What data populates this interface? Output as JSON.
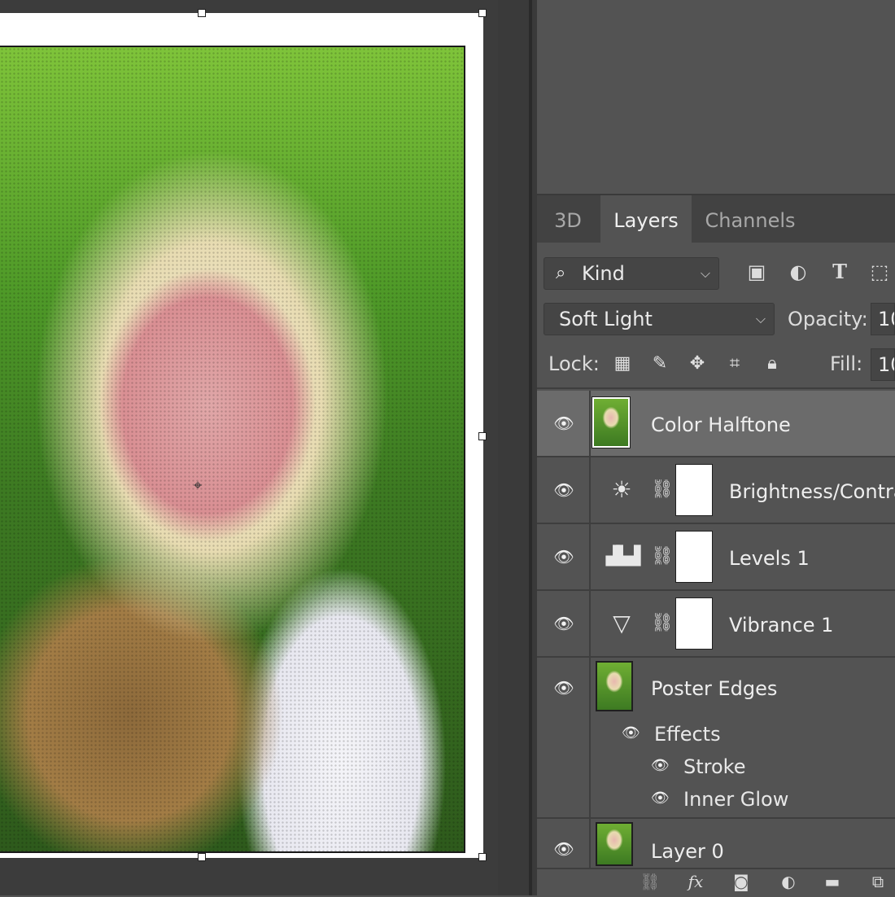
{
  "tabs": [
    "3D",
    "Layers",
    "Channels"
  ],
  "filter": {
    "label": "Kind",
    "icons": [
      "image-icon",
      "adjustment-icon",
      "type-icon",
      "shape-icon"
    ]
  },
  "blend": {
    "mode": "Soft Light",
    "opacity_label": "Opacity:",
    "opacity_value": "10"
  },
  "lock": {
    "label": "Lock:",
    "icons": [
      "lock-transparent-icon",
      "lock-paint-icon",
      "lock-move-icon",
      "lock-artboard-icon",
      "lock-all-icon"
    ],
    "fill_label": "Fill:",
    "fill_value": "10"
  },
  "layers": [
    {
      "name": "Color Halftone",
      "type": "pixel",
      "selected": true
    },
    {
      "name": "Brightness/Contra",
      "type": "adjustment",
      "icon": "brightness-icon"
    },
    {
      "name": "Levels 1",
      "type": "adjustment",
      "icon": "levels-icon"
    },
    {
      "name": "Vibrance 1",
      "type": "adjustment",
      "icon": "vibrance-icon"
    },
    {
      "name": "Poster Edges",
      "type": "pixel",
      "effects_label": "Effects",
      "effects": [
        "Stroke",
        "Inner Glow"
      ]
    },
    {
      "name": "Layer 0",
      "type": "pixel"
    }
  ],
  "bottom_icons": [
    "link-icon",
    "fx-icon",
    "mask-icon",
    "new-adjustment-icon",
    "group-folder-icon",
    "new-layer-icon"
  ],
  "bottom_fx_text": "fx",
  "colors": {
    "panel_bg": "#535353",
    "selected_row": "#6b6b6b",
    "tab_bar": "#424242",
    "canvas_bg": "#3c3c3c"
  }
}
